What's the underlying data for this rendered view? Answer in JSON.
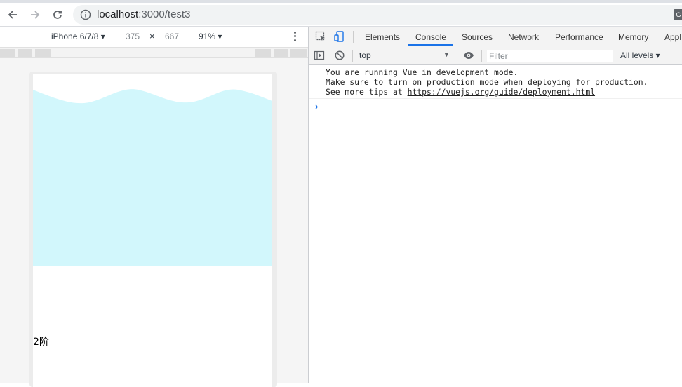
{
  "browser": {
    "url_host": "localhost",
    "url_path": ":3000/test3",
    "translate_glyph": "G"
  },
  "device_toolbar": {
    "device": "iPhone 6/7/8 ▾",
    "width": "375",
    "times": "×",
    "height": "667",
    "zoom": "91% ▾"
  },
  "page": {
    "wave_color": "#d2f7fc",
    "step_label": "2阶"
  },
  "devtools": {
    "tabs": [
      "Elements",
      "Console",
      "Sources",
      "Network",
      "Performance",
      "Memory",
      "Appl"
    ],
    "active_tab": "Console",
    "context": "top",
    "filter_placeholder": "Filter",
    "levels": "All levels ▾",
    "console_lines": [
      "You are running Vue in development mode.",
      "Make sure to turn on production mode when deploying for production.",
      "See more tips at "
    ],
    "console_link": "https://vuejs.org/guide/deployment.html",
    "prompt_glyph": "›"
  }
}
